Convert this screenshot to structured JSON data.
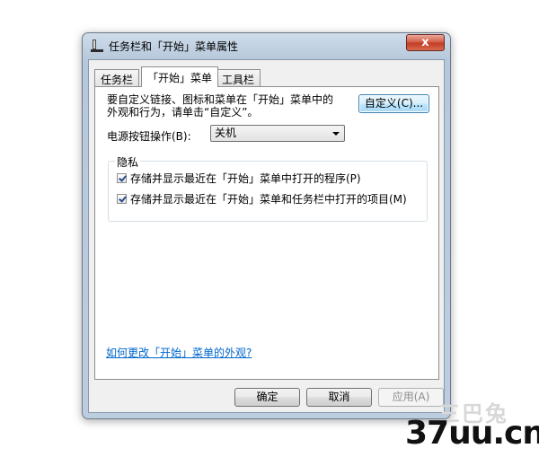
{
  "window": {
    "title": "任务栏和「开始」菜单属性",
    "close_glyph": "x"
  },
  "tabs": [
    {
      "label": "任务栏",
      "active": false
    },
    {
      "label": "「开始」菜单",
      "active": true
    },
    {
      "label": "工具栏",
      "active": false
    }
  ],
  "panel": {
    "description_line1": "要自定义链接、图标和菜单在「开始」菜单中的",
    "description_line2": "外观和行为，请单击“自定义”。",
    "customize_label": "自定义(C)...",
    "power_label": "电源按钮操作(B):",
    "power_value": "关机",
    "privacy_title": "隐私",
    "checkbox1_label": "存储并显示最近在「开始」菜单中打开的程序(P)",
    "checkbox1_checked": true,
    "checkbox2_label": "存储并显示最近在「开始」菜单和任务栏中打开的项目(M)",
    "checkbox2_checked": true,
    "help_link": "如何更改「开始」菜单的外观?"
  },
  "buttons": {
    "ok": "确定",
    "cancel": "取消",
    "apply": "应用(A)"
  },
  "watermark": {
    "logo_text": "三巴兔",
    "site": "37uu.cn"
  }
}
